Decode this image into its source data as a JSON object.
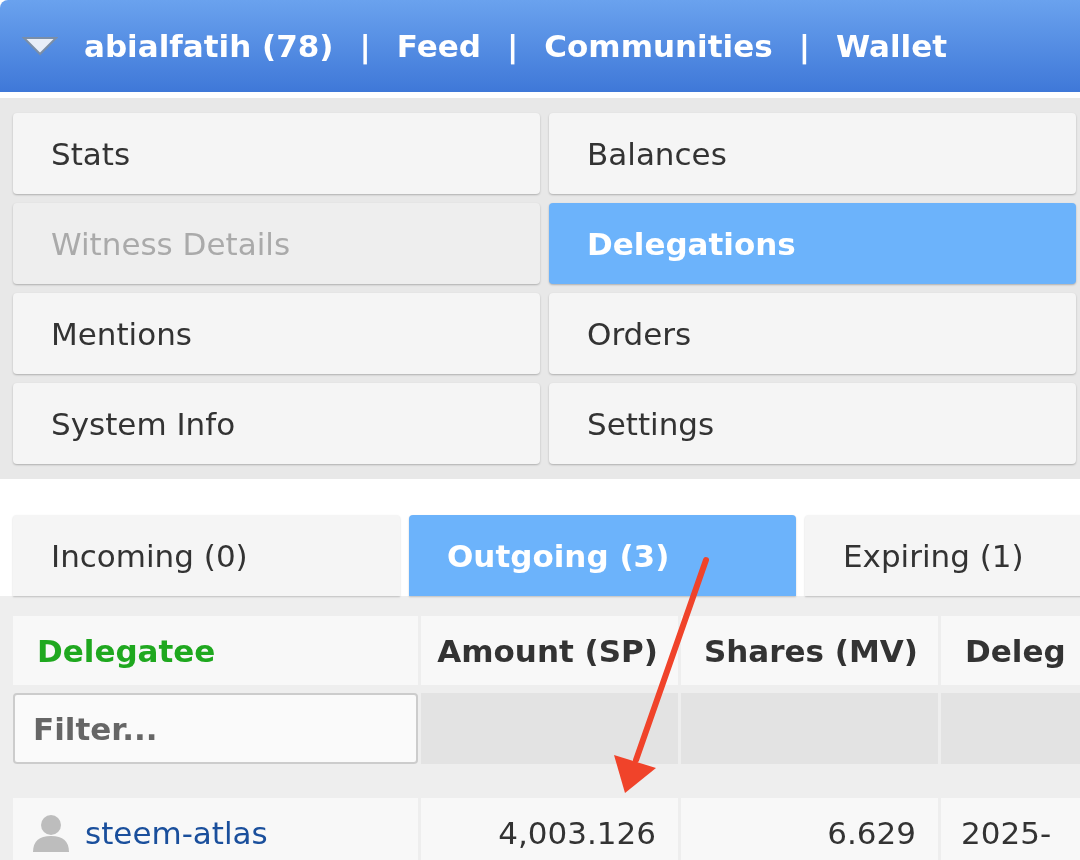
{
  "header": {
    "user": "abialfatih (78)",
    "links": [
      {
        "separator": "|",
        "label": "Feed"
      },
      {
        "separator": "|",
        "label": "Communities"
      },
      {
        "separator": "|",
        "label": "Wallet"
      }
    ]
  },
  "menu": [
    {
      "label": "Stats",
      "selected": false,
      "disabled": false
    },
    {
      "label": "Balances",
      "selected": false,
      "disabled": false
    },
    {
      "label": "Witness Details",
      "selected": false,
      "disabled": true
    },
    {
      "label": "Delegations",
      "selected": true,
      "disabled": false
    },
    {
      "label": "Mentions",
      "selected": false,
      "disabled": false
    },
    {
      "label": "Orders",
      "selected": false,
      "disabled": false
    },
    {
      "label": "System Info",
      "selected": false,
      "disabled": false
    },
    {
      "label": "Settings",
      "selected": false,
      "disabled": false
    }
  ],
  "tabs": [
    {
      "label": "Incoming (0)",
      "selected": false
    },
    {
      "label": "Outgoing (3)",
      "selected": true
    },
    {
      "label": "Expiring (1)",
      "selected": false
    }
  ],
  "table": {
    "columns": [
      {
        "label": "Delegatee",
        "sorted": true
      },
      {
        "label": "Amount (SP)",
        "sorted": false
      },
      {
        "label": "Shares (MV)",
        "sorted": false
      },
      {
        "label": "Deleg",
        "sorted": false
      }
    ],
    "filter": {
      "placeholder": "Filter..."
    },
    "rows": [
      {
        "delegatee": "steem-atlas",
        "amount": "4,003.126",
        "shares": "6.629",
        "column_4": "2025-"
      }
    ]
  }
}
